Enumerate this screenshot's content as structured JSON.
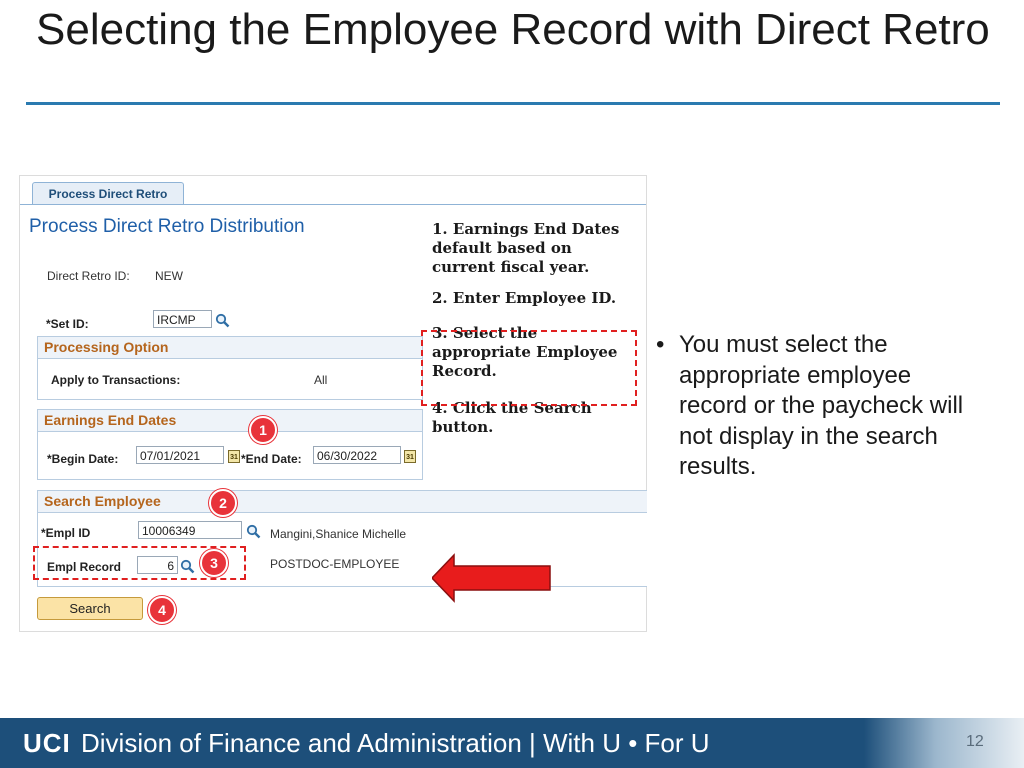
{
  "slide": {
    "title": "Selecting the Employee Record with Direct Retro",
    "bullet": "You must select the appropriate employee record or the paycheck will not display in the search results.",
    "page_number": "12"
  },
  "footer": {
    "brand": "UCI",
    "text": "Division of Finance and Administration | With U • For U"
  },
  "form": {
    "tab_label": "Process Direct Retro",
    "heading": "Process Direct Retro Distribution",
    "direct_retro_id_label": "Direct Retro ID:",
    "direct_retro_id_value": "NEW",
    "set_id_label": "*Set ID:",
    "set_id_value": "IRCMP",
    "processing_option": {
      "header": "Processing Option",
      "apply_label": "Apply to Transactions:",
      "apply_value": "All"
    },
    "earnings_end_dates": {
      "header": "Earnings End Dates",
      "begin_label": "*Begin Date:",
      "begin_value": "07/01/2021",
      "end_label": "*End Date:",
      "end_value": "06/30/2022"
    },
    "search_employee": {
      "header": "Search Employee",
      "empl_id_label": "*Empl ID",
      "empl_id_value": "10006349",
      "employee_name": "Mangini,Shanice Michelle",
      "empl_record_label": "Empl Record",
      "empl_record_value": "6",
      "job_description": "POSTDOC-EMPLOYEE"
    },
    "search_button": "Search",
    "calendar_icon_text": "31"
  },
  "badges": [
    "1",
    "2",
    "3",
    "4"
  ],
  "notes": [
    "1. Earnings End Dates default based on current fiscal year.",
    "2. Enter Employee ID.",
    "3. Select the appropriate Employee Record.",
    "4. Click the Search button."
  ],
  "colors": {
    "accent_rule": "#2a7ab0",
    "footer_bg": "#1d4f7a",
    "section_header_text": "#b5651d",
    "badge": "#e8333a",
    "arrow": "#e81c1c"
  },
  "icons": [
    "search-icon",
    "calendar-icon",
    "arrow-left-icon"
  ]
}
